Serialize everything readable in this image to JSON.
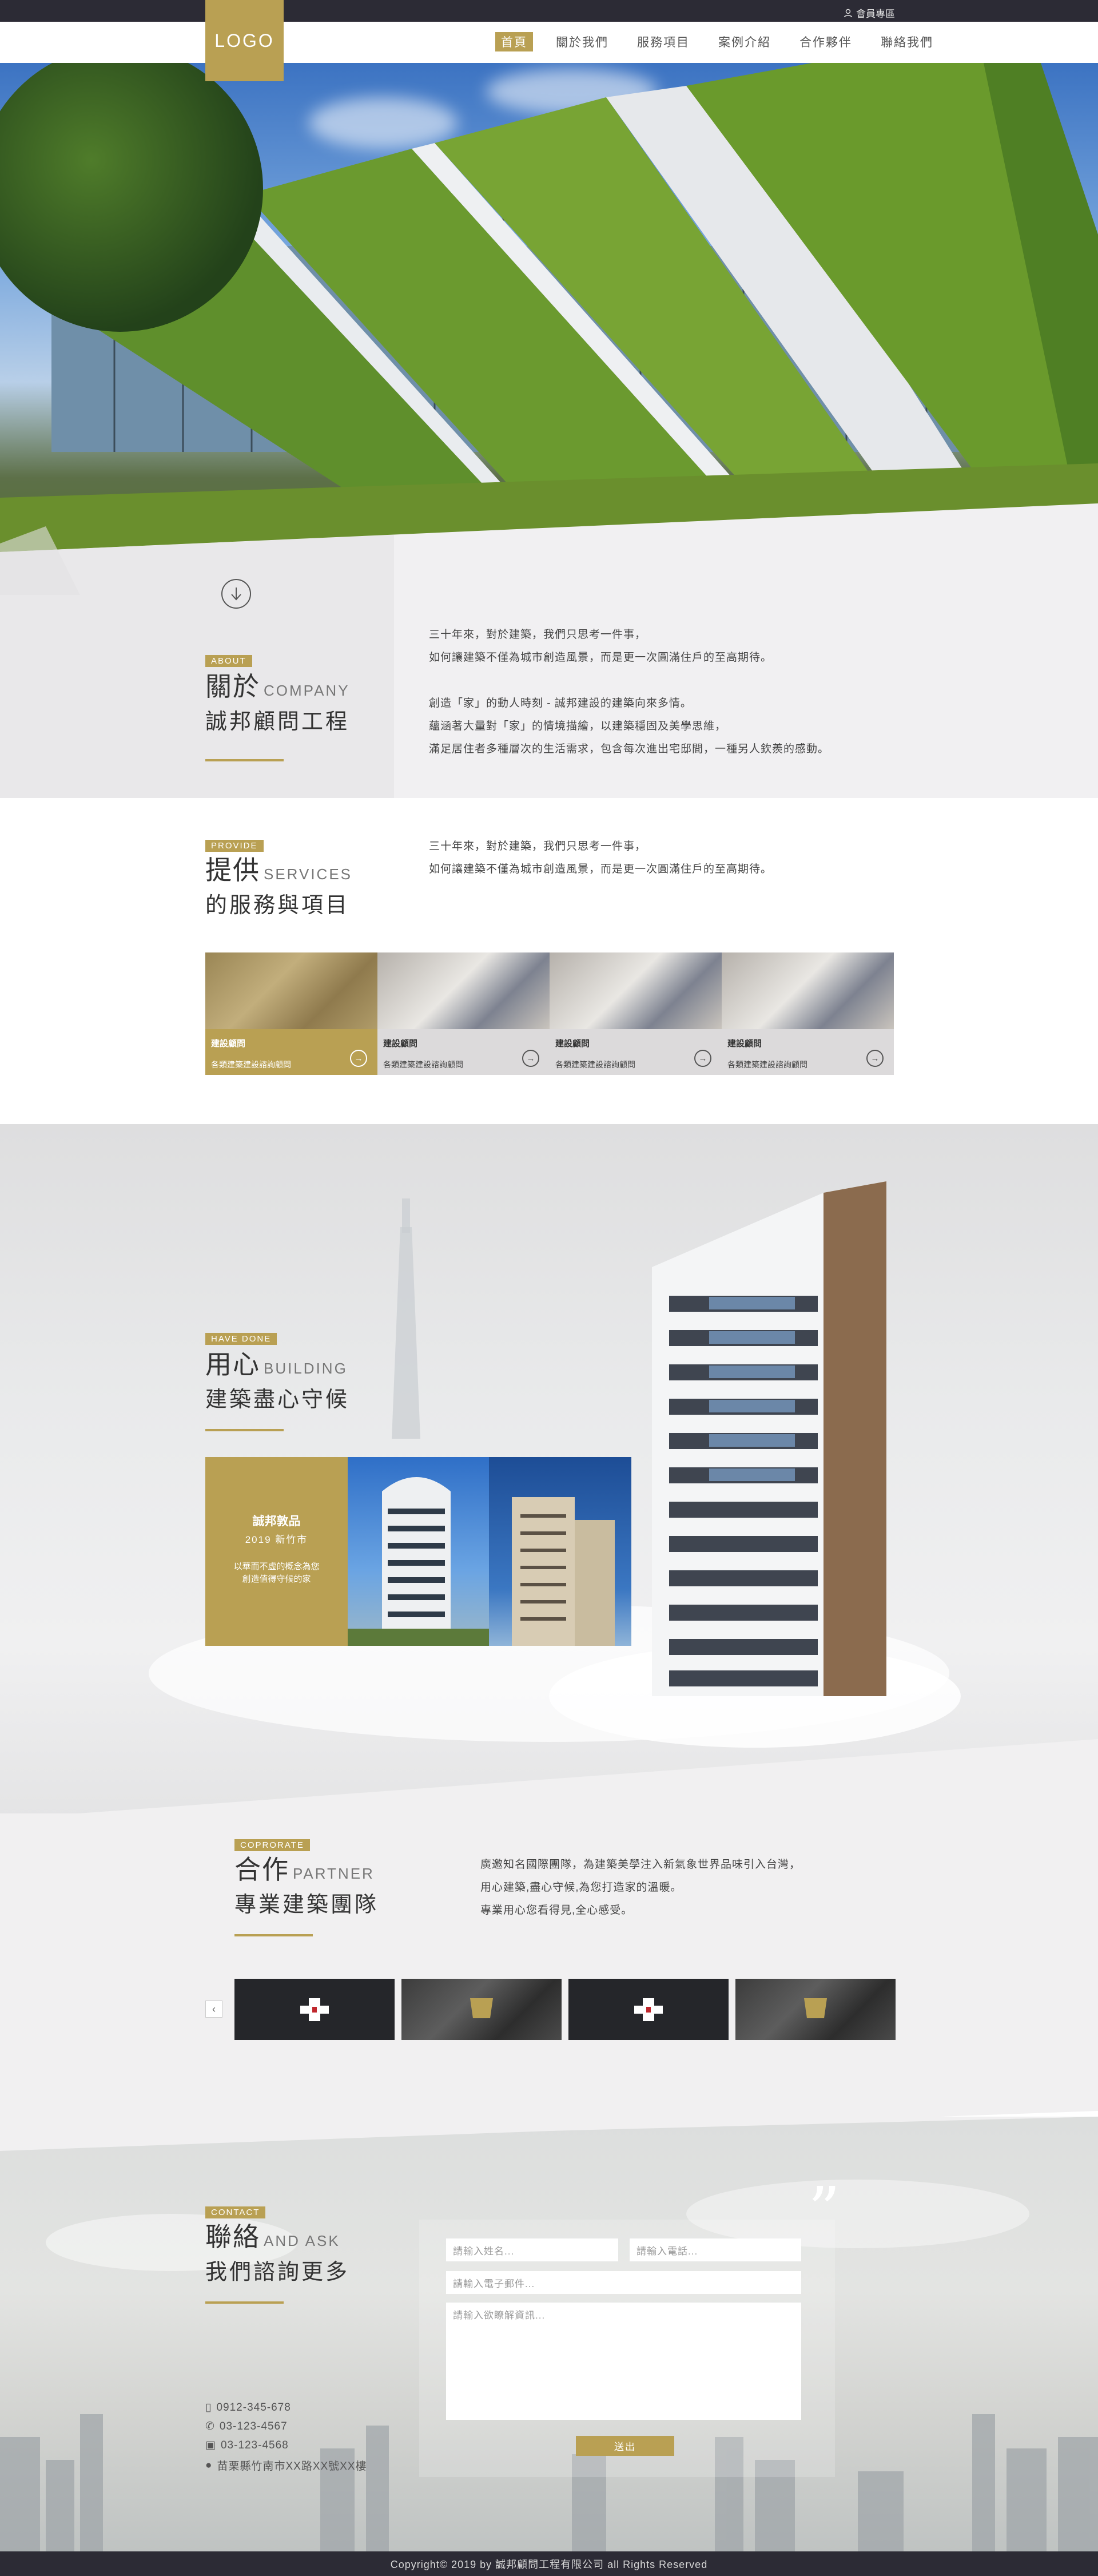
{
  "topbar": {
    "member_label": "會員專區"
  },
  "brand": {
    "logo": "LOGO"
  },
  "nav": {
    "items": [
      "首頁",
      "關於我們",
      "服務項目",
      "案例介紹",
      "合作夥伴",
      "聯絡我們"
    ],
    "active": "首頁"
  },
  "about": {
    "tag": "ABOUT",
    "title": "關於",
    "title_en": "COMPANY",
    "subtitle": "誠邦顧問工程",
    "paragraphs": [
      "三十年來，對於建築，我們只思考一件事，",
      "如何讓建築不僅為城市創造風景，而是更一次圓滿住戶的至高期待。",
      "",
      "創造「家」的動人時刻 - 誠邦建設的建築向來多情。",
      "蘊涵著大量對「家」的情境描繪，以建築穩固及美學思維，",
      "滿足居住者多種層次的生活需求，包含每次進出宅邸間，一種另人欽羨的感動。"
    ]
  },
  "services": {
    "tag": "PROVIDE",
    "title": "提供",
    "title_en": "SERVICES",
    "subtitle": "的服務與項目",
    "paragraphs": [
      "三十年來，對於建築，我們只思考一件事，",
      "如何讓建築不僅為城市創造風景，而是更一次圓滿住戶的至高期待。"
    ],
    "cards": [
      {
        "title": "建設顧問",
        "desc": "各類建築建設諮詢顧問",
        "highlight": true
      },
      {
        "title": "建設顧問",
        "desc": "各類建築建設諮詢顧問",
        "highlight": false
      },
      {
        "title": "建設顧問",
        "desc": "各類建築建設諮詢顧問",
        "highlight": false
      },
      {
        "title": "建設顧問",
        "desc": "各類建築建設諮詢顧問",
        "highlight": false
      }
    ]
  },
  "building": {
    "tag": "HAVE DONE",
    "title": "用心",
    "title_en": "BUILDING",
    "subtitle": "建築盡心守候",
    "featured": {
      "name": "誠邦敦品",
      "year": "2019 新竹市",
      "line1": "以華而不虛的概念為您",
      "line2": "創造值得守候的家"
    }
  },
  "partner": {
    "tag": "COPRORATE",
    "title": "合作",
    "title_en": "PARTNER",
    "subtitle": "專業建築團隊",
    "paragraphs": [
      "廣邀知名國際團隊，為建築美學注入新氣象世界品味引入台灣，",
      "用心建築,盡心守候,為您打造家的溫暖。",
      "專業用心您看得見,全心感受。"
    ],
    "prev": "‹",
    "next": "›"
  },
  "contact": {
    "tag": "CONTACT",
    "title": "聯絡",
    "title_en": "AND ASK",
    "subtitle": "我們諮詢更多",
    "name_placeholder": "請輸入姓名...",
    "phone_placeholder": "請輸入電話...",
    "email_placeholder": "請輸入電子郵件...",
    "message_placeholder": "請輸入欲瞭解資訊...",
    "send_label": "送出",
    "mobile": "0912-345-678",
    "tel": "03-123-4567",
    "fax": "03-123-4568",
    "address": "苗栗縣竹南市XX路XX號XX樓"
  },
  "footer": {
    "copyright": "Copyright© 2019 by 誠邦顧問工程有限公司 all Rights Reserved"
  },
  "colors": {
    "gold": "#b9a053",
    "dark": "#2c2b35"
  }
}
